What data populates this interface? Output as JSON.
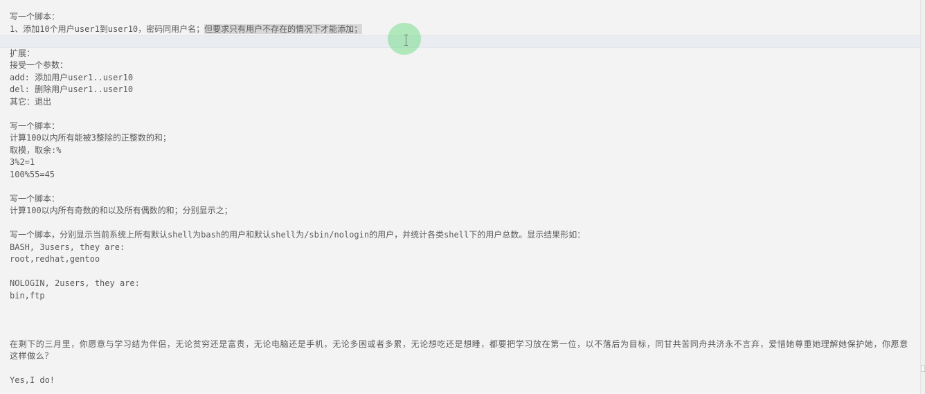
{
  "document": {
    "lines": [
      "写一个脚本：",
      "1、添加10个用户user1到user10，密码同用户名；",
      "但要求只有用户不存在的情况下才能添加；",
      "",
      "扩展：",
      "接受一个参数：",
      "add: 添加用户user1..user10",
      "del: 删除用户user1..user10",
      "其它：退出",
      "",
      "写一个脚本：",
      "计算100以内所有能被3整除的正整数的和；",
      "取模，取余:%",
      "3%2=1",
      "100%55=45",
      "",
      "写一个脚本：",
      "计算100以内所有奇数的和以及所有偶数的和；分别显示之；",
      "",
      "写一个脚本，分别显示当前系统上所有默认shell为bash的用户和默认shell为/sbin/nologin的用户，并统计各类shell下的用户总数。显示结果形如：",
      "BASH, 3users, they are:",
      "root,redhat,gentoo",
      "",
      "NOLOGIN, 2users, they are:",
      "bin,ftp",
      "",
      "",
      "",
      "在剩下的三月里，你愿意与学习结为伴侣，无论贫穷还是富贵，无论电脑还是手机，无论多困或者多累，无论想吃还是想睡，都要把学习放在第一位，以不落后为目标，同甘共苦同舟共济永不言弃，爱惜她尊重她理解她保护她，你愿意这样做么？",
      "",
      "Yes,I do!"
    ]
  }
}
